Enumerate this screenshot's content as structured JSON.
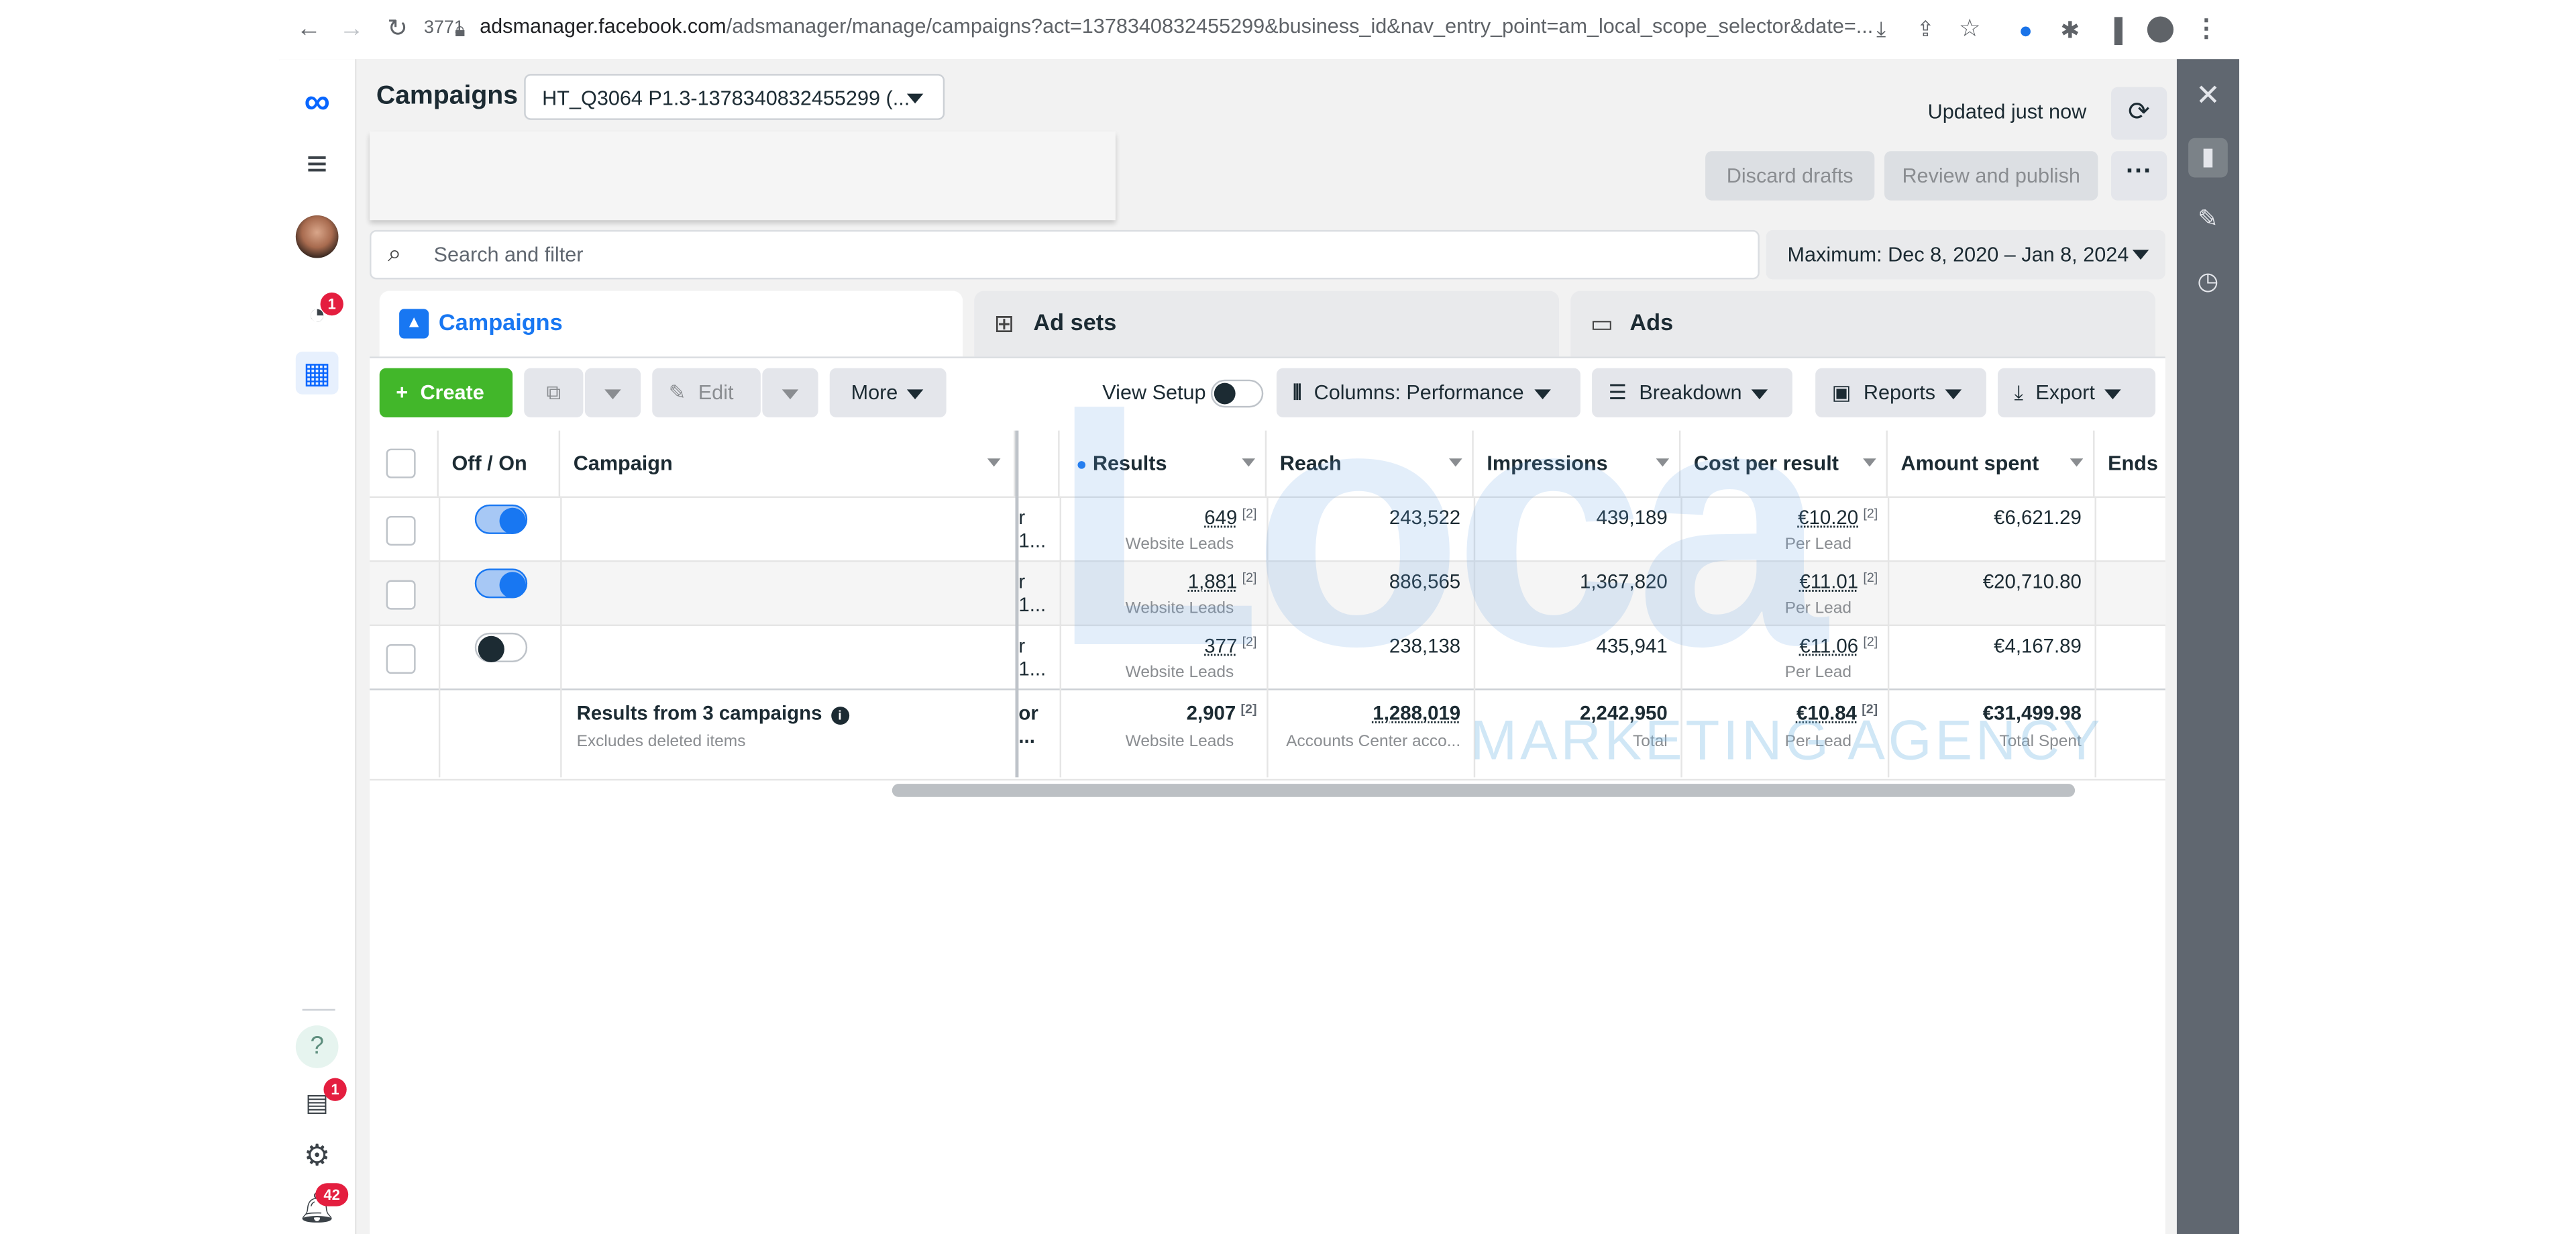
{
  "browser": {
    "tab_count": "3771",
    "url_host": "adsmanager.facebook.com",
    "url_path": "/adsmanager/manage/campaigns?act=1378340832455299&business_id&nav_entry_point=am_local_scope_selector&date=..."
  },
  "rail": {
    "notifications_badge": "1",
    "inbox_badge": "1",
    "alerts_badge": "42"
  },
  "header": {
    "title": "Campaigns",
    "account_selector": "HT_Q3064 P1.3-1378340832455299 (...",
    "updated_text": "Updated just now",
    "discard_drafts": "Discard drafts",
    "review_publish": "Review and publish",
    "more_menu": "···"
  },
  "search": {
    "placeholder": "Search and filter",
    "date_range": "Maximum: Dec 8, 2020 – Jan 8, 2024"
  },
  "tabs": [
    {
      "label": "Campaigns"
    },
    {
      "label": "Ad sets"
    },
    {
      "label": "Ads"
    }
  ],
  "toolbar": {
    "create": "Create",
    "edit": "Edit",
    "more": "More",
    "view_setup": "View Setup",
    "columns": "Columns: Performance",
    "breakdown": "Breakdown",
    "reports": "Reports",
    "export": "Export"
  },
  "columns": {
    "off_on": "Off / On",
    "campaign": "Campaign",
    "results": "Results",
    "reach": "Reach",
    "impressions": "Impressions",
    "cost_per_result": "Cost per result",
    "amount_spent": "Amount spent",
    "ends": "Ends"
  },
  "rows": [
    {
      "truncated": "r 1...",
      "results": "649",
      "results_sub": "Website Leads",
      "reach": "243,522",
      "impressions": "439,189",
      "cpr": "€10.20",
      "cpr_sub": "Per Lead",
      "spent": "€6,621.29",
      "on": true
    },
    {
      "truncated": "r 1...",
      "results": "1,881",
      "results_sub": "Website Leads",
      "reach": "886,565",
      "impressions": "1,367,820",
      "cpr": "€11.01",
      "cpr_sub": "Per Lead",
      "spent": "€20,710.80",
      "on": true
    },
    {
      "truncated": "r 1...",
      "results": "377",
      "results_sub": "Website Leads",
      "reach": "238,138",
      "impressions": "435,941",
      "cpr": "€11.06",
      "cpr_sub": "Per Lead",
      "spent": "€4,167.89",
      "on": false
    }
  ],
  "summary": {
    "title": "Results from 3 campaigns",
    "subtitle": "Excludes deleted items",
    "truncated": "or ...",
    "results": "2,907",
    "results_sub": "Website Leads",
    "reach": "1,288,019",
    "reach_sub": "Accounts Center acco...",
    "impressions": "2,242,950",
    "impressions_sub": "Total",
    "cpr": "€10.84",
    "cpr_sub": "Per Lead",
    "spent": "€31,499.98",
    "spent_sub": "Total Spent"
  },
  "footnote_mark": "[2]",
  "watermark": {
    "big": "Loca",
    "small": "MARKETING AGENCY"
  },
  "colors": {
    "accent_blue": "#1877f2",
    "create_green": "#42b72a",
    "badge_red": "#e41e3f"
  }
}
